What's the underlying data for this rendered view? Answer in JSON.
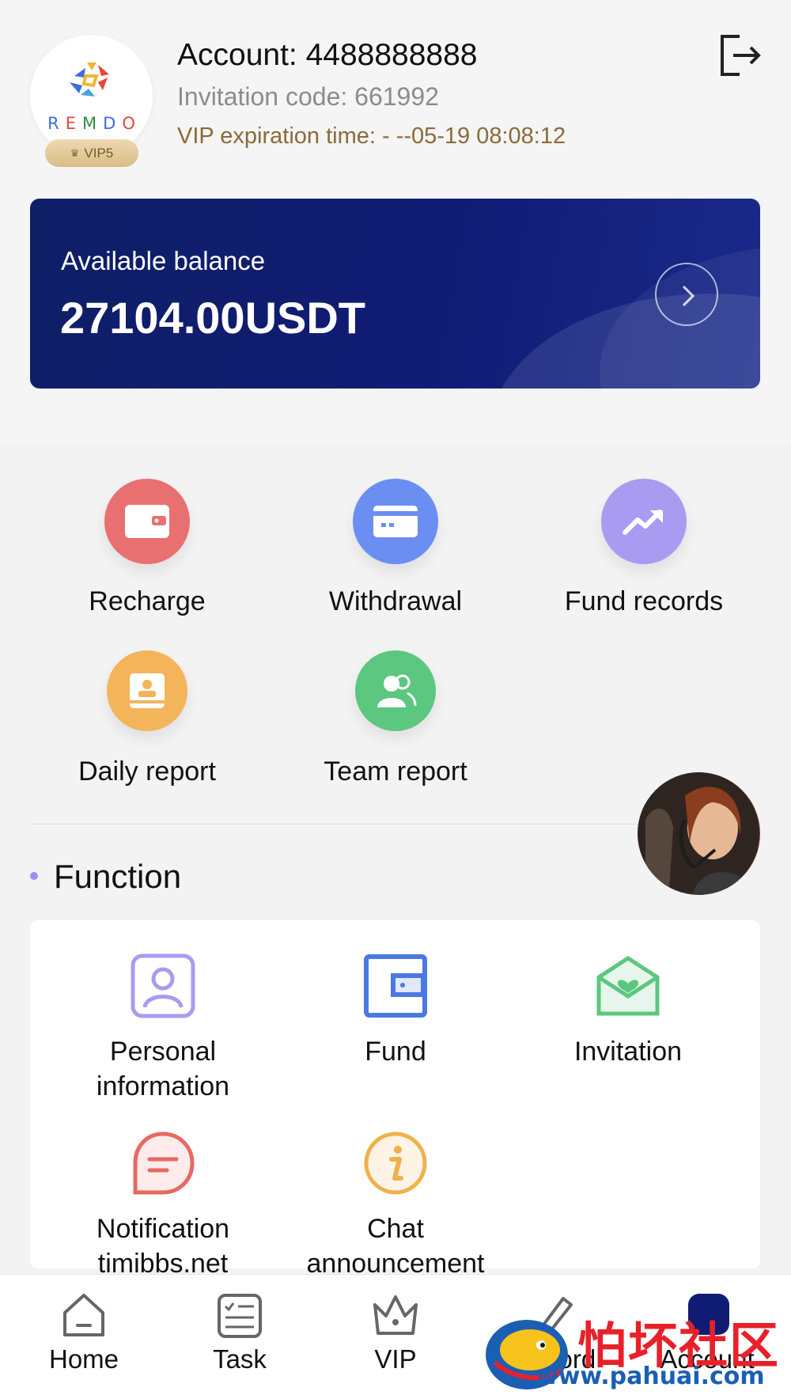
{
  "header": {
    "logo_letters": [
      "R",
      "E",
      "M",
      "D",
      "O"
    ],
    "vip_level": "VIP5",
    "account_text": "Account: 4488888888",
    "invitation_text": "Invitation code: 661992",
    "vip_expiration_text": "VIP expiration time:  -  --05-19 08:08:12"
  },
  "balance": {
    "label": "Available balance",
    "value": "27104.00USDT"
  },
  "quick_actions": [
    {
      "label": "Recharge",
      "icon": "wallet-icon",
      "color": "#e97070"
    },
    {
      "label": "Withdrawal",
      "icon": "card-icon",
      "color": "#6b8ef2"
    },
    {
      "label": "Fund records",
      "icon": "trend-up-icon",
      "color": "#a99bf2"
    },
    {
      "label": "Daily report",
      "icon": "report-icon",
      "color": "#f3b45a"
    },
    {
      "label": "Team report",
      "icon": "team-icon",
      "color": "#5cc77f"
    }
  ],
  "function_section": {
    "title": "Function",
    "items": [
      {
        "label": "Personal information",
        "icon": "user-card-icon"
      },
      {
        "label": "Fund",
        "icon": "wallet-outline-icon"
      },
      {
        "label": "Invitation",
        "icon": "envelope-heart-icon"
      },
      {
        "label": "Notification timibbs.net",
        "icon": "message-icon"
      },
      {
        "label": "Chat announcement",
        "icon": "info-icon"
      }
    ]
  },
  "bottom_nav": [
    {
      "label": "Home",
      "icon": "home-icon"
    },
    {
      "label": "Task",
      "icon": "task-list-icon"
    },
    {
      "label": "VIP",
      "icon": "crown-icon"
    },
    {
      "label": "Record",
      "icon": "edit-icon"
    },
    {
      "label": "Account",
      "icon": "account-icon"
    }
  ],
  "watermark": {
    "text": "怕坏社区",
    "url": "www.pahuai.com"
  },
  "colors": {
    "card_bg": "#101c74",
    "vip_gold": "#8b6a3a",
    "accent_purple": "#9c8ef0"
  }
}
